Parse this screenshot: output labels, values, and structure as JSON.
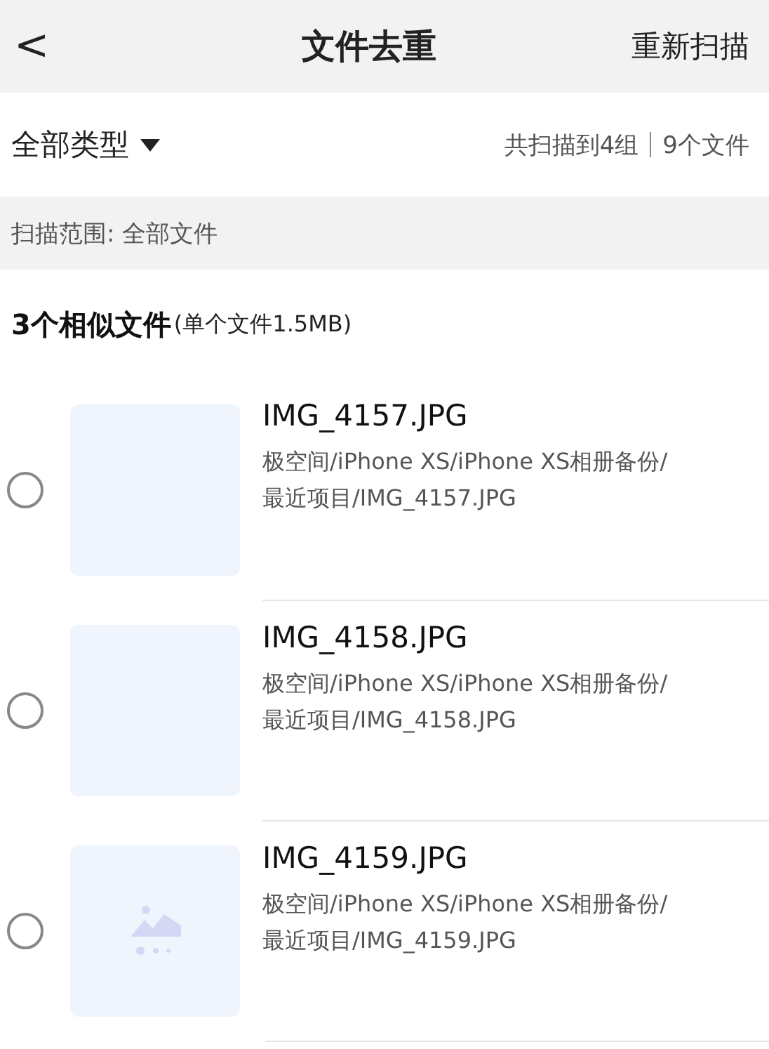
{
  "nav": {
    "back": "<",
    "title": "文件去重",
    "action": "重新扫描"
  },
  "filter": {
    "type_label": "全部类型",
    "groups": "共扫描到4组",
    "files": "9个文件"
  },
  "scope": "扫描范围: 全部文件",
  "group": {
    "title": "3个相似文件",
    "note": "(单个文件1.5MB)",
    "items": [
      {
        "name": "IMG_4157.JPG",
        "path_lines": [
          "极空间/iPhone XS/iPhone XS相册备份/",
          "最近项目/IMG_4157.JPG"
        ],
        "selected": false,
        "kind": "blank"
      },
      {
        "name": "IMG_4158.JPG",
        "path_lines": [
          "极空间/iPhone XS/iPhone XS相册备份/",
          "最近项目/IMG_4158.JPG"
        ],
        "selected": false,
        "kind": "blank"
      },
      {
        "name": "IMG_4159.JPG",
        "path_lines": [
          "极空间/iPhone XS/iPhone XS相册备份/",
          "最近项目/IMG_4159.JPG"
        ],
        "selected": false,
        "kind": "placeholder"
      }
    ]
  }
}
